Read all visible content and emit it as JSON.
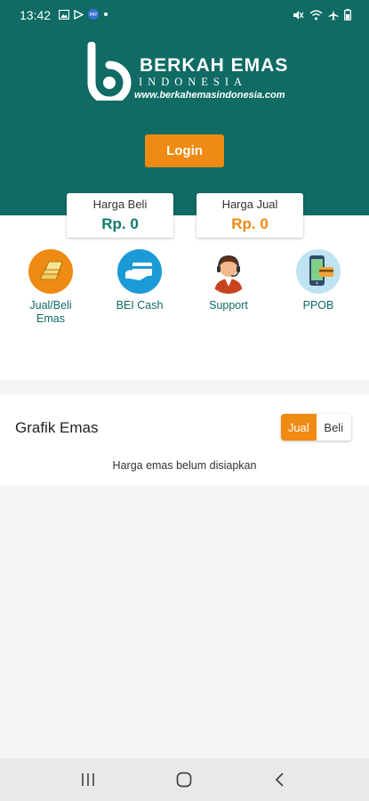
{
  "status_bar": {
    "time": "13:42",
    "left_icons": [
      "image-icon",
      "play-icon",
      "app-icon",
      "dot-icon"
    ],
    "right_icons": [
      "mute-icon",
      "wifi-icon",
      "airplane-icon",
      "battery-icon"
    ]
  },
  "brand": {
    "name": "BERKAH EMAS",
    "subtitle": "INDONESIA",
    "url": "www.berkahemasindonesia.com"
  },
  "login": {
    "label": "Login"
  },
  "prices": {
    "buy": {
      "label": "Harga Beli",
      "value": "Rp. 0"
    },
    "sell": {
      "label": "Harga Jual",
      "value": "Rp. 0"
    }
  },
  "menu": [
    {
      "label": "Jual/Beli\nEmas",
      "icon": "gold-bars-icon"
    },
    {
      "label": "BEI Cash",
      "icon": "card-cash-icon"
    },
    {
      "label": "Support",
      "icon": "support-agent-icon"
    },
    {
      "label": "PPOB",
      "icon": "phone-payment-icon"
    }
  ],
  "chart": {
    "title": "Grafik Emas",
    "toggle": {
      "jual": "Jual",
      "beli": "Beli",
      "active": "Jual"
    },
    "empty_message": "Harga emas belum disiapkan"
  },
  "colors": {
    "header_bg": "#0f6b63",
    "accent_orange": "#ef8a12",
    "buy_value": "#0f7a6d"
  },
  "nav": {
    "buttons": [
      "recents-icon",
      "home-icon",
      "back-icon"
    ]
  }
}
